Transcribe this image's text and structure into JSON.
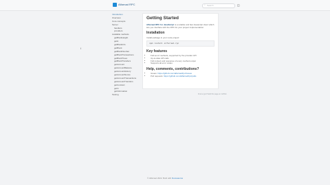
{
  "header": {
    "logo_text": "Alfarnad RPC",
    "search_placeholder": "Search",
    "repo_icon": "github-icon"
  },
  "sidebar": {
    "items": [
      {
        "label": "Introduction",
        "level": 0,
        "group": true
      },
      {
        "label": "Overview",
        "level": 0
      },
      {
        "label": "Core concepts",
        "level": 0
      },
      {
        "label": "Server",
        "level": 0
      },
      {
        "label": "handlers",
        "level": 1
      },
      {
        "label": "providers",
        "level": 1
      },
      {
        "label": "Available methods",
        "level": 0
      },
      {
        "label": "getBlockHeight",
        "level": 1
      },
      {
        "label": "getH",
        "level": 1
      },
      {
        "label": "getBlockInfo",
        "level": 1
      },
      {
        "label": "getBlock",
        "level": 1
      },
      {
        "label": "getBlockNumber",
        "level": 1
      },
      {
        "label": "getBlockTransactions",
        "level": 1
      },
      {
        "label": "getBlockTrees",
        "level": 1
      },
      {
        "label": "getBlockTransfers",
        "level": 1
      },
      {
        "label": "getAccount",
        "level": 1
      },
      {
        "label": "getAccountBalance",
        "level": 1
      },
      {
        "label": "getAccountHistory",
        "level": 1
      },
      {
        "label": "getAccountNonce",
        "level": 1
      },
      {
        "label": "getAccountTransactions",
        "level": 1
      },
      {
        "label": "getAccountTransfers",
        "level": 1
      },
      {
        "label": "getContract",
        "level": 1
      },
      {
        "label": "getIn",
        "level": 1
      },
      {
        "label": "getInformation",
        "level": 1
      },
      {
        "label": "Testing",
        "level": 0
      }
    ]
  },
  "content": {
    "title": "Getting Started",
    "intro_strong": "Alfarnad RPC for JavaScript",
    "intro_rest": " is a reliable and fast Javascript client which lets you interface with the RPC for your project implementation.",
    "install_heading": "Installation",
    "install_text": "Install package in your node project:",
    "install_code": "npm install alfarnad-rpc",
    "features_heading": "Key features",
    "features": [
      "Full set of methods, supported by the provider API",
      "Up-to-date API calls",
      "Full context and response of every method output",
      "Supports all error codes"
    ],
    "help_heading": "Help, comments, contributions?",
    "help_links": [
      {
        "prefix": "Issues: ",
        "link": "https://github.com/alfarnad/rpc/issues"
      },
      {
        "prefix": "Pull requests: ",
        "link": "https://github.com/alfarnad/rpc/pulls"
      }
    ]
  },
  "edit_link": "Find a typo? Edit this page on GitHub",
  "footer": {
    "prefix": "© Alfarnad 2022. Built with ",
    "link": "Docusaurus"
  }
}
